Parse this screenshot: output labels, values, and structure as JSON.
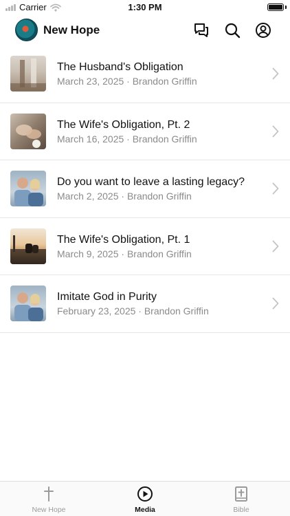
{
  "status_bar": {
    "carrier": "Carrier",
    "time": "1:30 PM"
  },
  "header": {
    "title": "New Hope",
    "icons": [
      "chat-icon",
      "search-icon",
      "account-icon"
    ]
  },
  "sermons": [
    {
      "title": "The Husband's Obligation",
      "subtitle": "March 23, 2025 · Brandon Griffin"
    },
    {
      "title": "The Wife's Obligation, Pt. 2",
      "subtitle": "March 16, 2025 · Brandon Griffin"
    },
    {
      "title": "Do you want to leave a lasting legacy?",
      "subtitle": "March 2, 2025 · Brandon Griffin"
    },
    {
      "title": "The Wife's Obligation, Pt. 1",
      "subtitle": "March 9, 2025 · Brandon Griffin"
    },
    {
      "title": "Imitate God in Purity",
      "subtitle": "February 23, 2025 · Brandon Griffin"
    }
  ],
  "tab_bar": {
    "tabs": [
      {
        "label": "New Hope",
        "icon": "cross-icon",
        "active": false
      },
      {
        "label": "Media",
        "icon": "play-icon",
        "active": true
      },
      {
        "label": "Bible",
        "icon": "bible-icon",
        "active": false
      }
    ]
  },
  "colors": {
    "accent": "#111111",
    "secondary_text": "#8a8a8a",
    "inactive_tab": "#9a9a9a"
  }
}
